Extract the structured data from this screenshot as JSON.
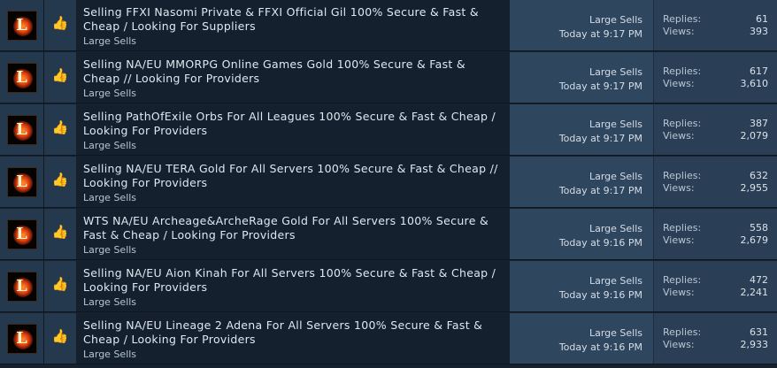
{
  "threads": [
    {
      "title": "Selling FFXI Nasomi Private & FFXI Official Gil 100% Secure & Fast & Cheap / Looking For Suppliers",
      "forum": "Large Sells",
      "lastpost_forum": "Large Sells",
      "lastpost_time": "Today at 9:17 PM",
      "replies_label": "Replies:",
      "replies": "61",
      "views_label": "Views:",
      "views": "393"
    },
    {
      "title": "Selling NA/EU MMORPG Online Games Gold 100% Secure & Fast & Cheap // Looking For Providers",
      "forum": "Large Sells",
      "lastpost_forum": "Large Sells",
      "lastpost_time": "Today at 9:17 PM",
      "replies_label": "Replies:",
      "replies": "617",
      "views_label": "Views:",
      "views": "3,610"
    },
    {
      "title": "Selling PathOfExile Orbs For All Leagues 100% Secure & Fast & Cheap / Looking For Providers",
      "forum": "Large Sells",
      "lastpost_forum": "Large Sells",
      "lastpost_time": "Today at 9:17 PM",
      "replies_label": "Replies:",
      "replies": "387",
      "views_label": "Views:",
      "views": "2,079"
    },
    {
      "title": "Selling NA/EU TERA Gold For All Servers 100% Secure & Fast & Cheap // Looking For Providers",
      "forum": "Large Sells",
      "lastpost_forum": "Large Sells",
      "lastpost_time": "Today at 9:17 PM",
      "replies_label": "Replies:",
      "replies": "632",
      "views_label": "Views:",
      "views": "2,955"
    },
    {
      "title": "WTS NA/EU Archeage&ArcheRage Gold For All Servers 100% Secure & Fast & Cheap / Looking For Providers",
      "forum": "Large Sells",
      "lastpost_forum": "Large Sells",
      "lastpost_time": "Today at 9:16 PM",
      "replies_label": "Replies:",
      "replies": "558",
      "views_label": "Views:",
      "views": "2,679"
    },
    {
      "title": "Selling NA/EU Aion Kinah For All Servers 100% Secure & Fast & Cheap / Looking For Providers",
      "forum": "Large Sells",
      "lastpost_forum": "Large Sells",
      "lastpost_time": "Today at 9:16 PM",
      "replies_label": "Replies:",
      "replies": "472",
      "views_label": "Views:",
      "views": "2,241"
    },
    {
      "title": "Selling NA/EU Lineage 2 Adena For All Servers 100% Secure & Fast & Cheap / Looking For Providers",
      "forum": "Large Sells",
      "lastpost_forum": "Large Sells",
      "lastpost_time": "Today at 9:16 PM",
      "replies_label": "Replies:",
      "replies": "631",
      "views_label": "Views:",
      "views": "2,933"
    }
  ],
  "avatar_letter": "L",
  "icons": {
    "avatar": "flaming-L-avatar-icon",
    "thumb": "thumbs-up-icon"
  },
  "colors": {
    "title_text": "#dfe8f0",
    "avatar_glow": "#d8360c",
    "thumb": "#f2c44a"
  }
}
